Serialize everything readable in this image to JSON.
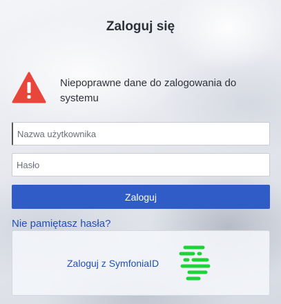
{
  "header": {
    "title": "Zaloguj się"
  },
  "alert": {
    "icon": "warning-triangle-icon",
    "color": "#e8463a",
    "message": "Niepoprawne dane do zalogowania do systemu"
  },
  "form": {
    "username_placeholder": "Nazwa użytkownika",
    "username_value": "",
    "password_placeholder": "Hasło",
    "password_value": "",
    "submit_label": "Zaloguj",
    "submit_color": "#2f5cc7"
  },
  "links": {
    "forgot_password": "Nie pamiętasz hasła?"
  },
  "sso": {
    "label": "Zaloguj z SymfoniaID",
    "logo_icon": "symfonia-logo-icon",
    "logo_color": "#1fd13a"
  }
}
